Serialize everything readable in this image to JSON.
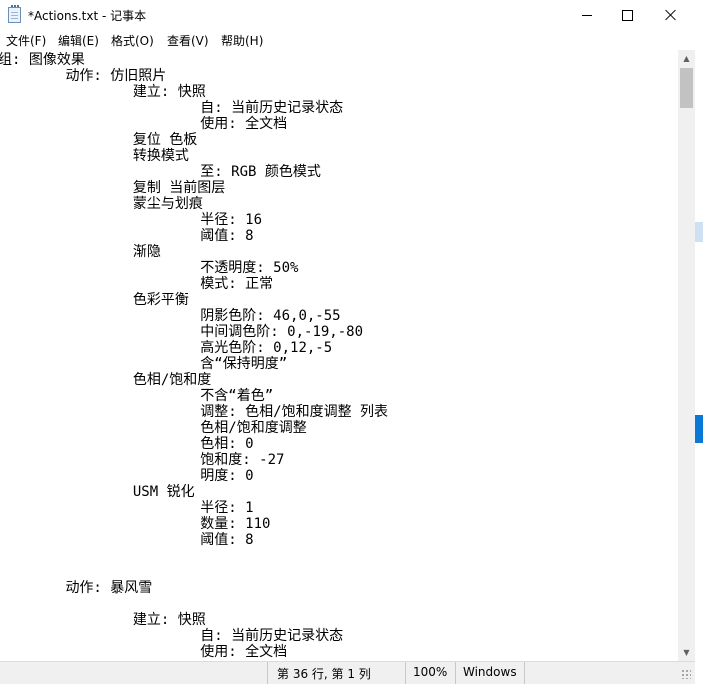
{
  "window": {
    "title": "*Actions.txt - 记事本"
  },
  "menubar": {
    "items": [
      "文件(F)",
      "编辑(E)",
      "格式(O)",
      "查看(V)",
      "帮助(H)"
    ]
  },
  "editor": {
    "content": "组: 图像效果\n\t动作: 仿旧照片\n\t\t建立: 快照\n\t\t\t自: 当前历史记录状态\n\t\t\t使用: 全文档\n\t\t复位 色板\n\t\t转换模式\n\t\t\t至: RGB 颜色模式\n\t\t复制 当前图层\n\t\t蒙尘与划痕\n\t\t\t半径: 16\n\t\t\t阈值: 8\n\t\t渐隐\n\t\t\t不透明度: 50%\n\t\t\t模式: 正常\n\t\t色彩平衡\n\t\t\t阴影色阶: 46,0,-55\n\t\t\t中间调色阶: 0,-19,-80\n\t\t\t高光色阶: 0,12,-5\n\t\t\t含“保持明度”\n\t\t色相/饱和度\n\t\t\t不含“着色”\n\t\t\t调整: 色相/饱和度调整 列表\n\t\t\t色相/饱和度调整\n\t\t\t色相: 0\n\t\t\t饱和度: -27\n\t\t\t明度: 0\n\t\tUSM 锐化\n\t\t\t半径: 1\n\t\t\t数量: 110\n\t\t\t阈值: 8\n\n\n\t动作: 暴风雪\n\n\t\t建立: 快照\n\t\t\t自: 当前历史记录状态\n\t\t\t使用: 全文档"
  },
  "statusbar": {
    "position": "第 36 行, 第 1 列",
    "zoom": "100%",
    "line_ending": "Windows"
  },
  "colors": {
    "accent": "#0a78d7",
    "chrome": "#f0f0f0"
  },
  "icons": [
    "notepad-icon",
    "minimize-icon",
    "maximize-icon",
    "close-icon",
    "scroll-up-arrow-icon",
    "scroll-down-arrow-icon",
    "resize-grip-icon"
  ]
}
